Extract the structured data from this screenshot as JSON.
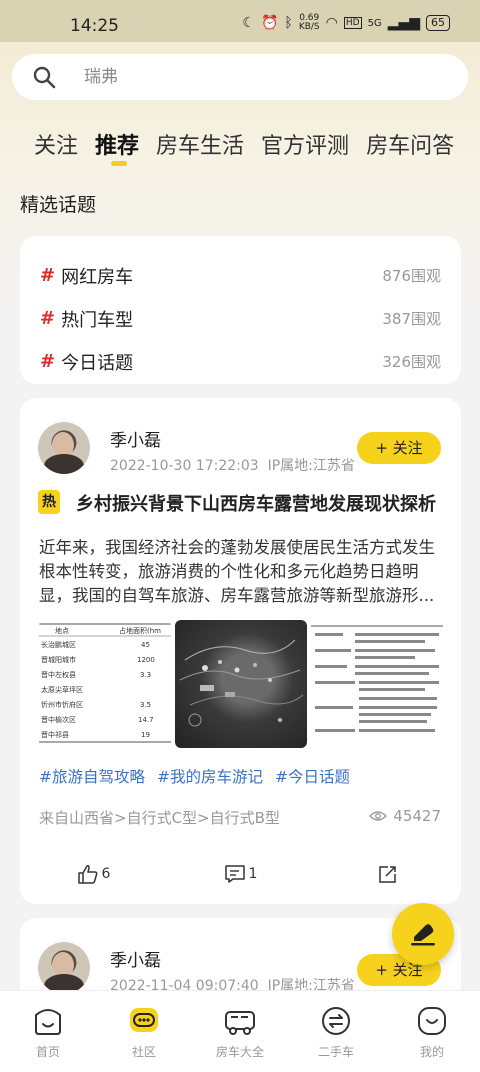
{
  "status_bar": {
    "time": "14:25",
    "speed_value": "0.69",
    "speed_unit": "KB/S",
    "network": "5G",
    "hd": "HD",
    "battery": "65"
  },
  "search": {
    "placeholder": "瑞弗"
  },
  "tabs": [
    {
      "label": "关注",
      "active": false
    },
    {
      "label": "推荐",
      "active": true
    },
    {
      "label": "房车生活",
      "active": false
    },
    {
      "label": "官方评测",
      "active": false
    },
    {
      "label": "房车问答",
      "active": false
    }
  ],
  "featured": {
    "title": "精选话题",
    "topics": [
      {
        "name": "网红房车",
        "count": "876围观"
      },
      {
        "name": "热门车型",
        "count": "387围观"
      },
      {
        "name": "今日话题",
        "count": "326围观"
      }
    ]
  },
  "post": {
    "author": "季小磊",
    "datetime": "2022-10-30 17:22:03",
    "ip": "IP属地:江苏省",
    "follow_label": "+ 关注",
    "hot_badge": "热",
    "title": "乡村振兴背景下山西房车露营地发展现状探析",
    "body": "近年来，我国经济社会的蓬勃发展使居民生活方式发生根本性转变，旅游消费的个性化和多元化趋势日趋明显，我国的自驾车旅游、房车露营旅游等新型旅游形...",
    "tags": [
      "#旅游自驾攻略",
      "#我的房车游记",
      "#今日话题"
    ],
    "source": "来自山西省>自行式C型>自行式B型",
    "views": "45427",
    "likes": "6",
    "comments": "1",
    "table_image": {
      "headers": [
        "地点",
        "占地面积(hm"
      ],
      "rows": [
        [
          "长治鹏城区",
          "45"
        ],
        [
          "晋城阳城市",
          "1200"
        ],
        [
          "晋中左权县",
          "3.3"
        ],
        [
          "太原尖草坪区",
          ""
        ],
        [
          "忻州市忻府区",
          "3.5"
        ],
        [
          "晋中榆次区",
          "14.7"
        ],
        [
          "晋中祁县",
          "19"
        ]
      ]
    }
  },
  "post2": {
    "author": "季小磊",
    "datetime": "2022-11-04 09:07:40",
    "ip": "IP属地:江苏省",
    "follow_label": "+ 关注"
  },
  "bottom_nav": [
    {
      "label": "首页",
      "icon": "home-icon"
    },
    {
      "label": "社区",
      "icon": "community-icon",
      "active": true
    },
    {
      "label": "房车大全",
      "icon": "rv-icon"
    },
    {
      "label": "二手车",
      "icon": "exchange-icon"
    },
    {
      "label": "我的",
      "icon": "profile-icon"
    }
  ],
  "colors": {
    "accent": "#f7d21c",
    "tag": "#3a72c2",
    "hash": "#e02a2a"
  }
}
